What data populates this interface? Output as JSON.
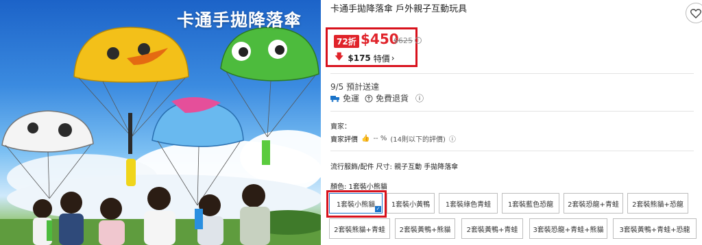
{
  "product_image": {
    "caption": "卡通手拋降落傘"
  },
  "product": {
    "title": "卡通手拋降落傘 戶外親子互動玩具"
  },
  "price": {
    "discount_badge": "72折",
    "current": "$450",
    "original": "$625",
    "info_icon": "i",
    "deal_arrow": "🡇",
    "deal_amount": "$175",
    "deal_label": "特價",
    "deal_chevron": "›"
  },
  "delivery": {
    "eta": "9/5 預計送達",
    "shipping": "免運",
    "returns": "免費退貨",
    "info_icon": "ⓘ"
  },
  "seller": {
    "label": "賣家：",
    "rating_label": "賣家評價",
    "rating_value": "-- %",
    "rating_note": "(14則以下的評價)",
    "info_icon": "ⓘ"
  },
  "spec": {
    "text": "流行服飾/配件 尺寸: 親子互動 手拋降落傘"
  },
  "color": {
    "label": "顏色: 1套裝小熊貓"
  },
  "options": [
    {
      "label": "1套裝小熊貓",
      "selected": true
    },
    {
      "label": "1套裝小黃鴨",
      "selected": false
    },
    {
      "label": "1套裝綠色青蛙",
      "selected": false
    },
    {
      "label": "1套裝藍色恐龍",
      "selected": false
    },
    {
      "label": "2套裝恐龍+青蛙",
      "selected": false
    },
    {
      "label": "2套裝熊貓+恐龍",
      "selected": false
    },
    {
      "label": "2套裝熊貓+青蛙",
      "selected": false
    },
    {
      "label": "2套裝黃鴨+熊貓",
      "selected": false
    },
    {
      "label": "2套裝黃鴨+青蛙",
      "selected": false
    },
    {
      "label": "3套裝恐龍+青蛙+熊貓",
      "selected": false
    },
    {
      "label": "3套裝黃鴨+青蛙+恐龍",
      "selected": false
    }
  ],
  "colors": {
    "accent_red": "#e0232a",
    "highlight_red": "#d8111c",
    "selected_blue": "#1a73c9"
  },
  "icons": {
    "favorite": "heart-icon",
    "truck": "truck-icon",
    "return": "return-icon",
    "thumb": "thumbs-up-icon",
    "check": "checkmark-icon"
  }
}
